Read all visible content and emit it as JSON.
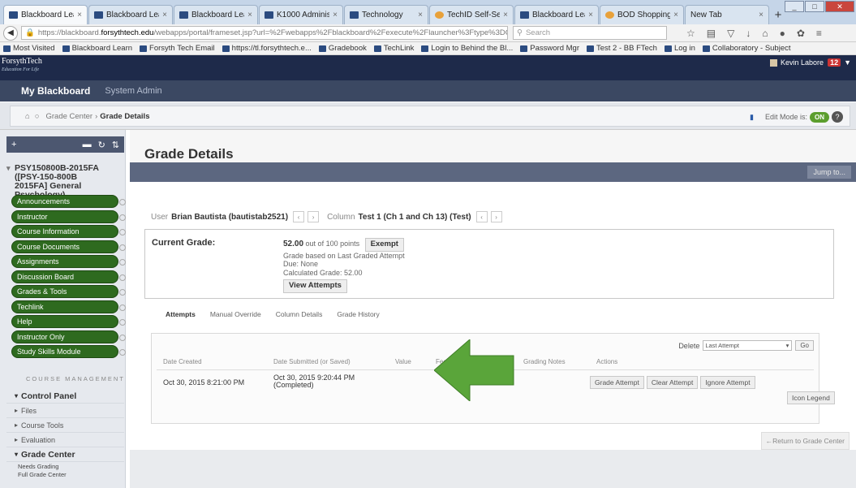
{
  "browser": {
    "tabs": [
      {
        "title": "Blackboard Learn",
        "fav": "bb"
      },
      {
        "title": "Blackboard Learn",
        "fav": "bb"
      },
      {
        "title": "Blackboard Learn",
        "fav": "bb"
      },
      {
        "title": "K1000 Administrator ...",
        "fav": "k"
      },
      {
        "title": "Technology",
        "fav": "doc"
      },
      {
        "title": "TechID Self-Servi...",
        "fav": "o"
      },
      {
        "title": "Blackboard Learn",
        "fav": "bb"
      },
      {
        "title": "BOD Shopping c...",
        "fav": "o"
      },
      {
        "title": "New Tab",
        "fav": "none"
      }
    ],
    "url_prefix": "https://blackboard.",
    "url_domain": "forsythtech.edu",
    "url_rest": "/webapps/portal/frameset.jsp?url=%2Fwebapps%2Fblackboard%2Fexecute%2Flauncher%3Ftype%3DCourse%26id%3D_189",
    "search_placeholder": "Search",
    "bookmarks": [
      "Most Visited",
      "Blackboard Learn",
      "Forsyth Tech Email",
      "https://tl.forsythtech.e...",
      "Gradebook",
      "TechLink",
      "Login to Behind the Bl...",
      "Password Mgr",
      "Test 2 - BB FTech",
      "Log in",
      "Collaboratory - Subject"
    ]
  },
  "header": {
    "logo": "ForsythTech",
    "logo_tagline": "Education For Life",
    "user": "Kevin Labore",
    "notifications": "12"
  },
  "nav": {
    "my_blackboard": "My Blackboard",
    "system_admin": "System Admin"
  },
  "breadcrumb": {
    "parent": "Grade Center",
    "current": "Grade Details",
    "edit_mode_label": "Edit Mode is:",
    "edit_mode_state": "ON"
  },
  "sidebar": {
    "course_title": "PSY150800B-2015FA ([PSY-150-800B 2015FA] General Psychology)",
    "menu": [
      "Announcements",
      "Instructor",
      "Course Information",
      "Course Documents",
      "Assignments",
      "Discussion Board",
      "Grades & Tools",
      "Techlink",
      "Help",
      "Instructor Only",
      "Study Skills Module"
    ],
    "course_management": "COURSE MANAGEMENT",
    "control_panel": [
      "Control Panel",
      "Files",
      "Course Tools",
      "Evaluation",
      "Grade Center",
      "Needs Grading",
      "Full Grade Center"
    ]
  },
  "page": {
    "title": "Grade Details",
    "jump_to": "Jump to...",
    "user_label": "User",
    "user_value": "Brian Bautista (bautistab2521)",
    "column_label": "Column",
    "column_value": "Test 1 (Ch 1 and Ch 13) (Test)",
    "current_grade_label": "Current Grade:",
    "score": "52.00",
    "out_of": "out of 100 points",
    "exempt": "Exempt",
    "based_on": "Grade based on Last Graded Attempt",
    "due": "Due: None",
    "calculated": "Calculated Grade: 52.00",
    "view_attempts": "View Attempts",
    "subtabs": [
      "Attempts",
      "Manual Override",
      "Column Details",
      "Grade History"
    ],
    "delete_label": "Delete",
    "delete_option": "Last Attempt",
    "go": "Go",
    "columns": [
      "Date Created",
      "Date Submitted (or Saved)",
      "Value",
      "Feedback to User",
      "Grading Notes",
      "Actions"
    ],
    "row": {
      "created": "Oct 30, 2015 8:21:00 PM",
      "submitted": "Oct 30, 2015 9:20:44 PM",
      "status": "(Completed)"
    },
    "actions": [
      "Grade Attempt",
      "Clear Attempt",
      "Ignore Attempt"
    ],
    "icon_legend": "Icon Legend",
    "return": "←Return to Grade Center"
  }
}
